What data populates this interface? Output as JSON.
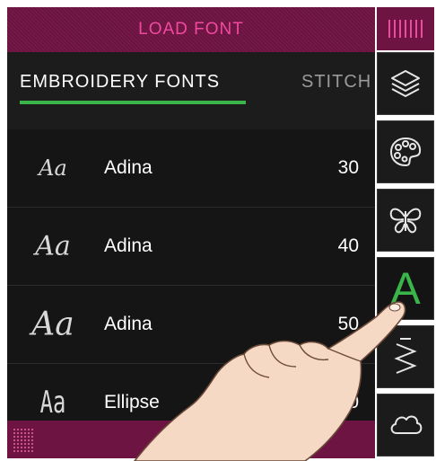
{
  "titlebar": {
    "title": "LOAD FONT"
  },
  "tabs": [
    {
      "label": "EMBROIDERY FONTS",
      "active": true
    },
    {
      "label": "STITCH",
      "active": false
    }
  ],
  "fonts": [
    {
      "preview": "Aa",
      "name": "Adina",
      "size": "30"
    },
    {
      "preview": "Aa",
      "name": "Adina",
      "size": "40"
    },
    {
      "preview": "Aa",
      "name": "Adina",
      "size": "50"
    },
    {
      "preview": "Aa",
      "name": "Ellipse",
      "size": "0"
    }
  ],
  "toolbar": {
    "items": [
      {
        "icon": "stitch-bars-icon"
      },
      {
        "icon": "layers-icon"
      },
      {
        "icon": "palette-icon"
      },
      {
        "icon": "butterfly-icon"
      },
      {
        "icon": "font-letter-icon",
        "letter": "A",
        "selected": true
      },
      {
        "icon": "zigzag-stitch-icon"
      },
      {
        "icon": "cloud-icon"
      }
    ]
  },
  "colors": {
    "accent_magenta": "#6e1443",
    "title_pink": "#f04aa0",
    "active_green": "#39b54a",
    "panel_bg": "#141414"
  }
}
